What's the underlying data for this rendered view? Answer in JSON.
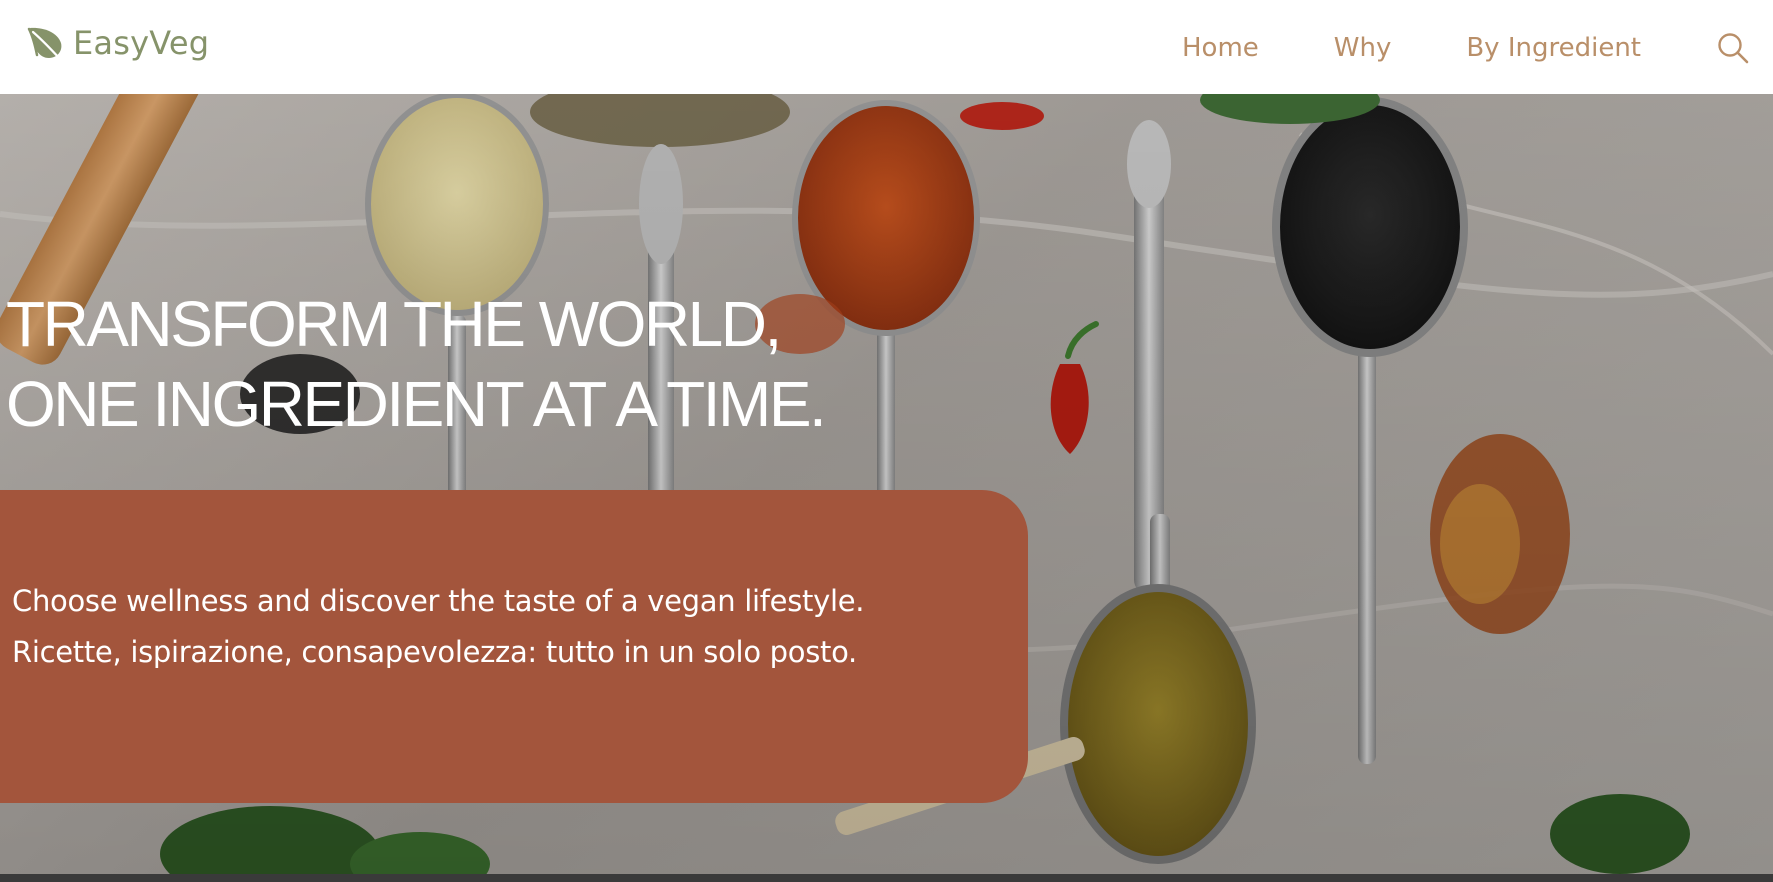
{
  "brand": {
    "name": "EasyVeg",
    "icon": "leaf-icon",
    "color": "#86936a"
  },
  "nav": {
    "items": [
      {
        "label": "Home"
      },
      {
        "label": "Why"
      },
      {
        "label": "By Ingredient"
      }
    ],
    "search_icon": "search-icon",
    "color": "#b98f69"
  },
  "hero": {
    "title_line1": "TRANSFORM THE WORLD,",
    "title_line2": "ONE INGREDIENT AT A TIME.",
    "subtitle_line1": "Choose wellness and discover the taste of a vegan lifestyle.",
    "subtitle_line2": "Ricette, ispirazione, consapevolezza: tutto in un solo posto.",
    "card_color": "#a3553c",
    "background_image": "spices-on-spoons-photo"
  }
}
